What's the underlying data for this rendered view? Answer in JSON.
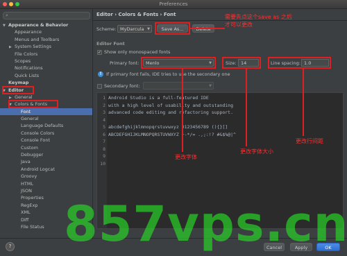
{
  "window": {
    "title": "Preferences"
  },
  "colors": {
    "accent": "#4b6eaf",
    "annotation": "#e02020",
    "watermark": "#28c828"
  },
  "sidebar": {
    "items": [
      {
        "label": "Appearance & Behavior",
        "arrow": "▼",
        "bold": true
      },
      {
        "label": "Appearance"
      },
      {
        "label": "Menus and Toolbars"
      },
      {
        "label": "System Settings",
        "arrow": "▶"
      },
      {
        "label": "File Colors"
      },
      {
        "label": "Scopes"
      },
      {
        "label": "Notifications"
      },
      {
        "label": "Quick Lists"
      },
      {
        "label": "Keymap",
        "bold": true
      },
      {
        "label": "Editor",
        "arrow": "▼",
        "bold": true
      },
      {
        "label": "General",
        "arrow": "▶"
      },
      {
        "label": "Colors & Fonts",
        "arrow": "▼"
      },
      {
        "label": "Font",
        "selected": true
      },
      {
        "label": "General"
      },
      {
        "label": "Language Defaults"
      },
      {
        "label": "Console Colors"
      },
      {
        "label": "Console Font"
      },
      {
        "label": "Custom"
      },
      {
        "label": "Debugger"
      },
      {
        "label": "Java"
      },
      {
        "label": "Android Logcat"
      },
      {
        "label": "Groovy"
      },
      {
        "label": "HTML"
      },
      {
        "label": "JSON"
      },
      {
        "label": "Properties"
      },
      {
        "label": "RegExp"
      },
      {
        "label": "XML"
      },
      {
        "label": "Diff"
      },
      {
        "label": "File Status"
      }
    ]
  },
  "main": {
    "breadcrumb": "Editor › Colors & Fonts › Font",
    "scheme_label": "Scheme:",
    "scheme_value": "MyDarcula",
    "save_as": "Save As...",
    "delete": "Delete",
    "section": "Editor Font",
    "monospaced_check": "✓",
    "monospaced_label": "Show only monospaced fonts",
    "primary_label": "Primary font:",
    "primary_value": "Menlo",
    "size_label": "Size:",
    "size_value": "14",
    "spacing_label": "Line spacing:",
    "spacing_value": "1.0",
    "info_text": "If primary font fails, IDE tries to use the secondary one",
    "secondary_label": "Secondary font:"
  },
  "preview": {
    "lines": [
      "Android Studio is a full-featured IDE",
      "with a high level of usability and outstanding",
      "advanced code editing and refactoring support.",
      "",
      "abcdefghijklmnopqrstuvwxyz 0123456789 (){}[]",
      "ABCDEFGHIJKLMNOPQRSTUVWXYZ +-*/= .,;:!? #&$%@|^",
      "",
      "",
      "",
      ""
    ],
    "line_numbers": [
      "1",
      "2",
      "3",
      "4",
      "5",
      "6",
      "7",
      "8",
      "9",
      "10"
    ]
  },
  "annotations": {
    "save_as_note": "需要先点这个save as 之后\n才可以更改",
    "font_note": "更改字体",
    "size_note": "更改字体大小",
    "spacing_note": "更改行间距"
  },
  "footer": {
    "cancel": "Cancel",
    "apply": "Apply",
    "ok": "OK",
    "help": "?"
  },
  "watermark": "857vps.cn"
}
